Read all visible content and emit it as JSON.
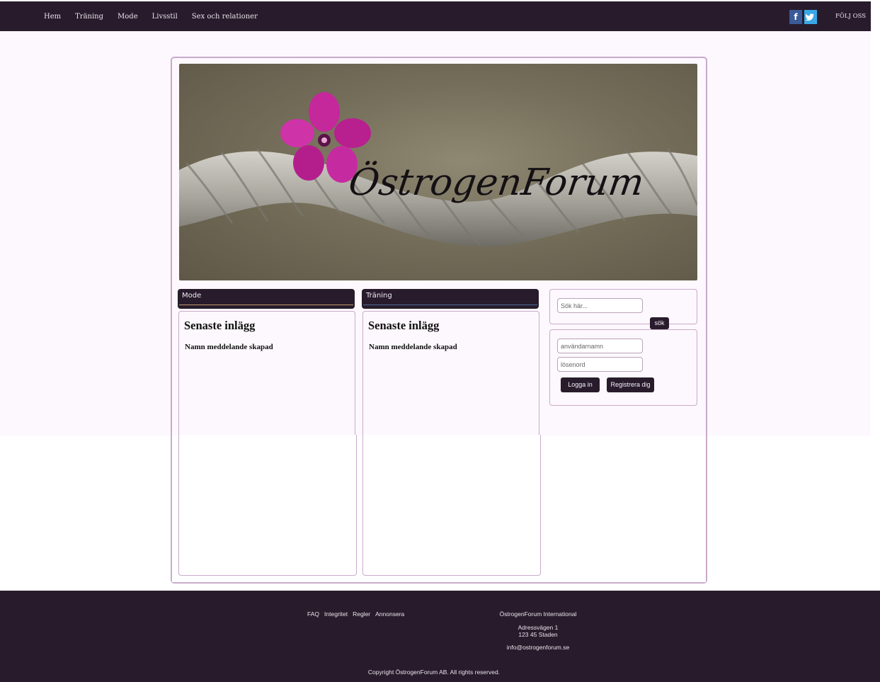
{
  "nav": {
    "items": [
      "Hem",
      "Träning",
      "Mode",
      "Livsstil",
      "Sex och relationer"
    ],
    "social": [
      "facebook-icon",
      "twitter-icon"
    ],
    "follow_label": "FÖLJ OSS"
  },
  "banner": {
    "title": "ÖstrogenForum"
  },
  "columns": {
    "mode": {
      "header": "Mode",
      "title": "Senaste inlägg",
      "subtitle": "Namn meddelande skapad"
    },
    "training": {
      "header": "Träning",
      "title": "Senaste inlägg",
      "subtitle": "Namn meddelande skapad"
    }
  },
  "search": {
    "placeholder": "Sök här...",
    "button_label": "sök"
  },
  "login": {
    "username_placeholder": "användarnamn",
    "password_placeholder": "lösenord",
    "login_label": "Logga in",
    "register_label": "Registrera dig"
  },
  "footer": {
    "links": [
      "FAQ",
      "Integritet",
      "Regler",
      "Annonsera"
    ],
    "company": "ÖstrogenForum International",
    "address_line1": "Adressvägen 1",
    "address_line2": "123 45 Staden",
    "email": "info@ostrogenforum.se",
    "copyright": "Copyright ÖstrogenForum AB. All rights reserved."
  },
  "colors": {
    "header_bg": "#281c2c",
    "border_accent": "#c9aacb",
    "page_bg": "#fdf8fd"
  }
}
